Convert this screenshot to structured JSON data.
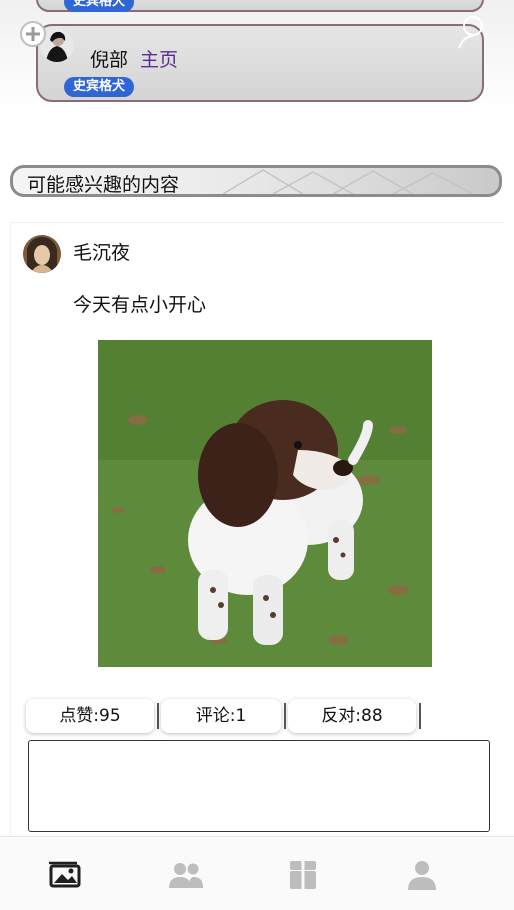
{
  "previous_card": {
    "badge": "史宾格犬"
  },
  "current_card": {
    "name": "倪部",
    "link": "主页",
    "badge": "史宾格犬"
  },
  "section": {
    "title": "可能感兴趣的内容"
  },
  "post": {
    "author": "毛沉夜",
    "text": "今天有点小开心",
    "photo_icon": "springer-spaniel-photo",
    "actions": {
      "like": "点赞:95",
      "comment": "评论:1",
      "oppose": "反对:88"
    },
    "comment_placeholder": ""
  },
  "tabbar": {
    "items": [
      {
        "icon": "photos-icon",
        "active": true
      },
      {
        "icon": "friends-icon",
        "active": false
      },
      {
        "icon": "box-icon",
        "active": false
      },
      {
        "icon": "profile-icon",
        "active": false
      }
    ]
  },
  "colors": {
    "accent_blue": "#2f66d6",
    "link_purple": "#5a2d91",
    "card_border": "#8a6b7c",
    "tab_active": "#222222",
    "tab_inactive": "#bdbdbd"
  }
}
